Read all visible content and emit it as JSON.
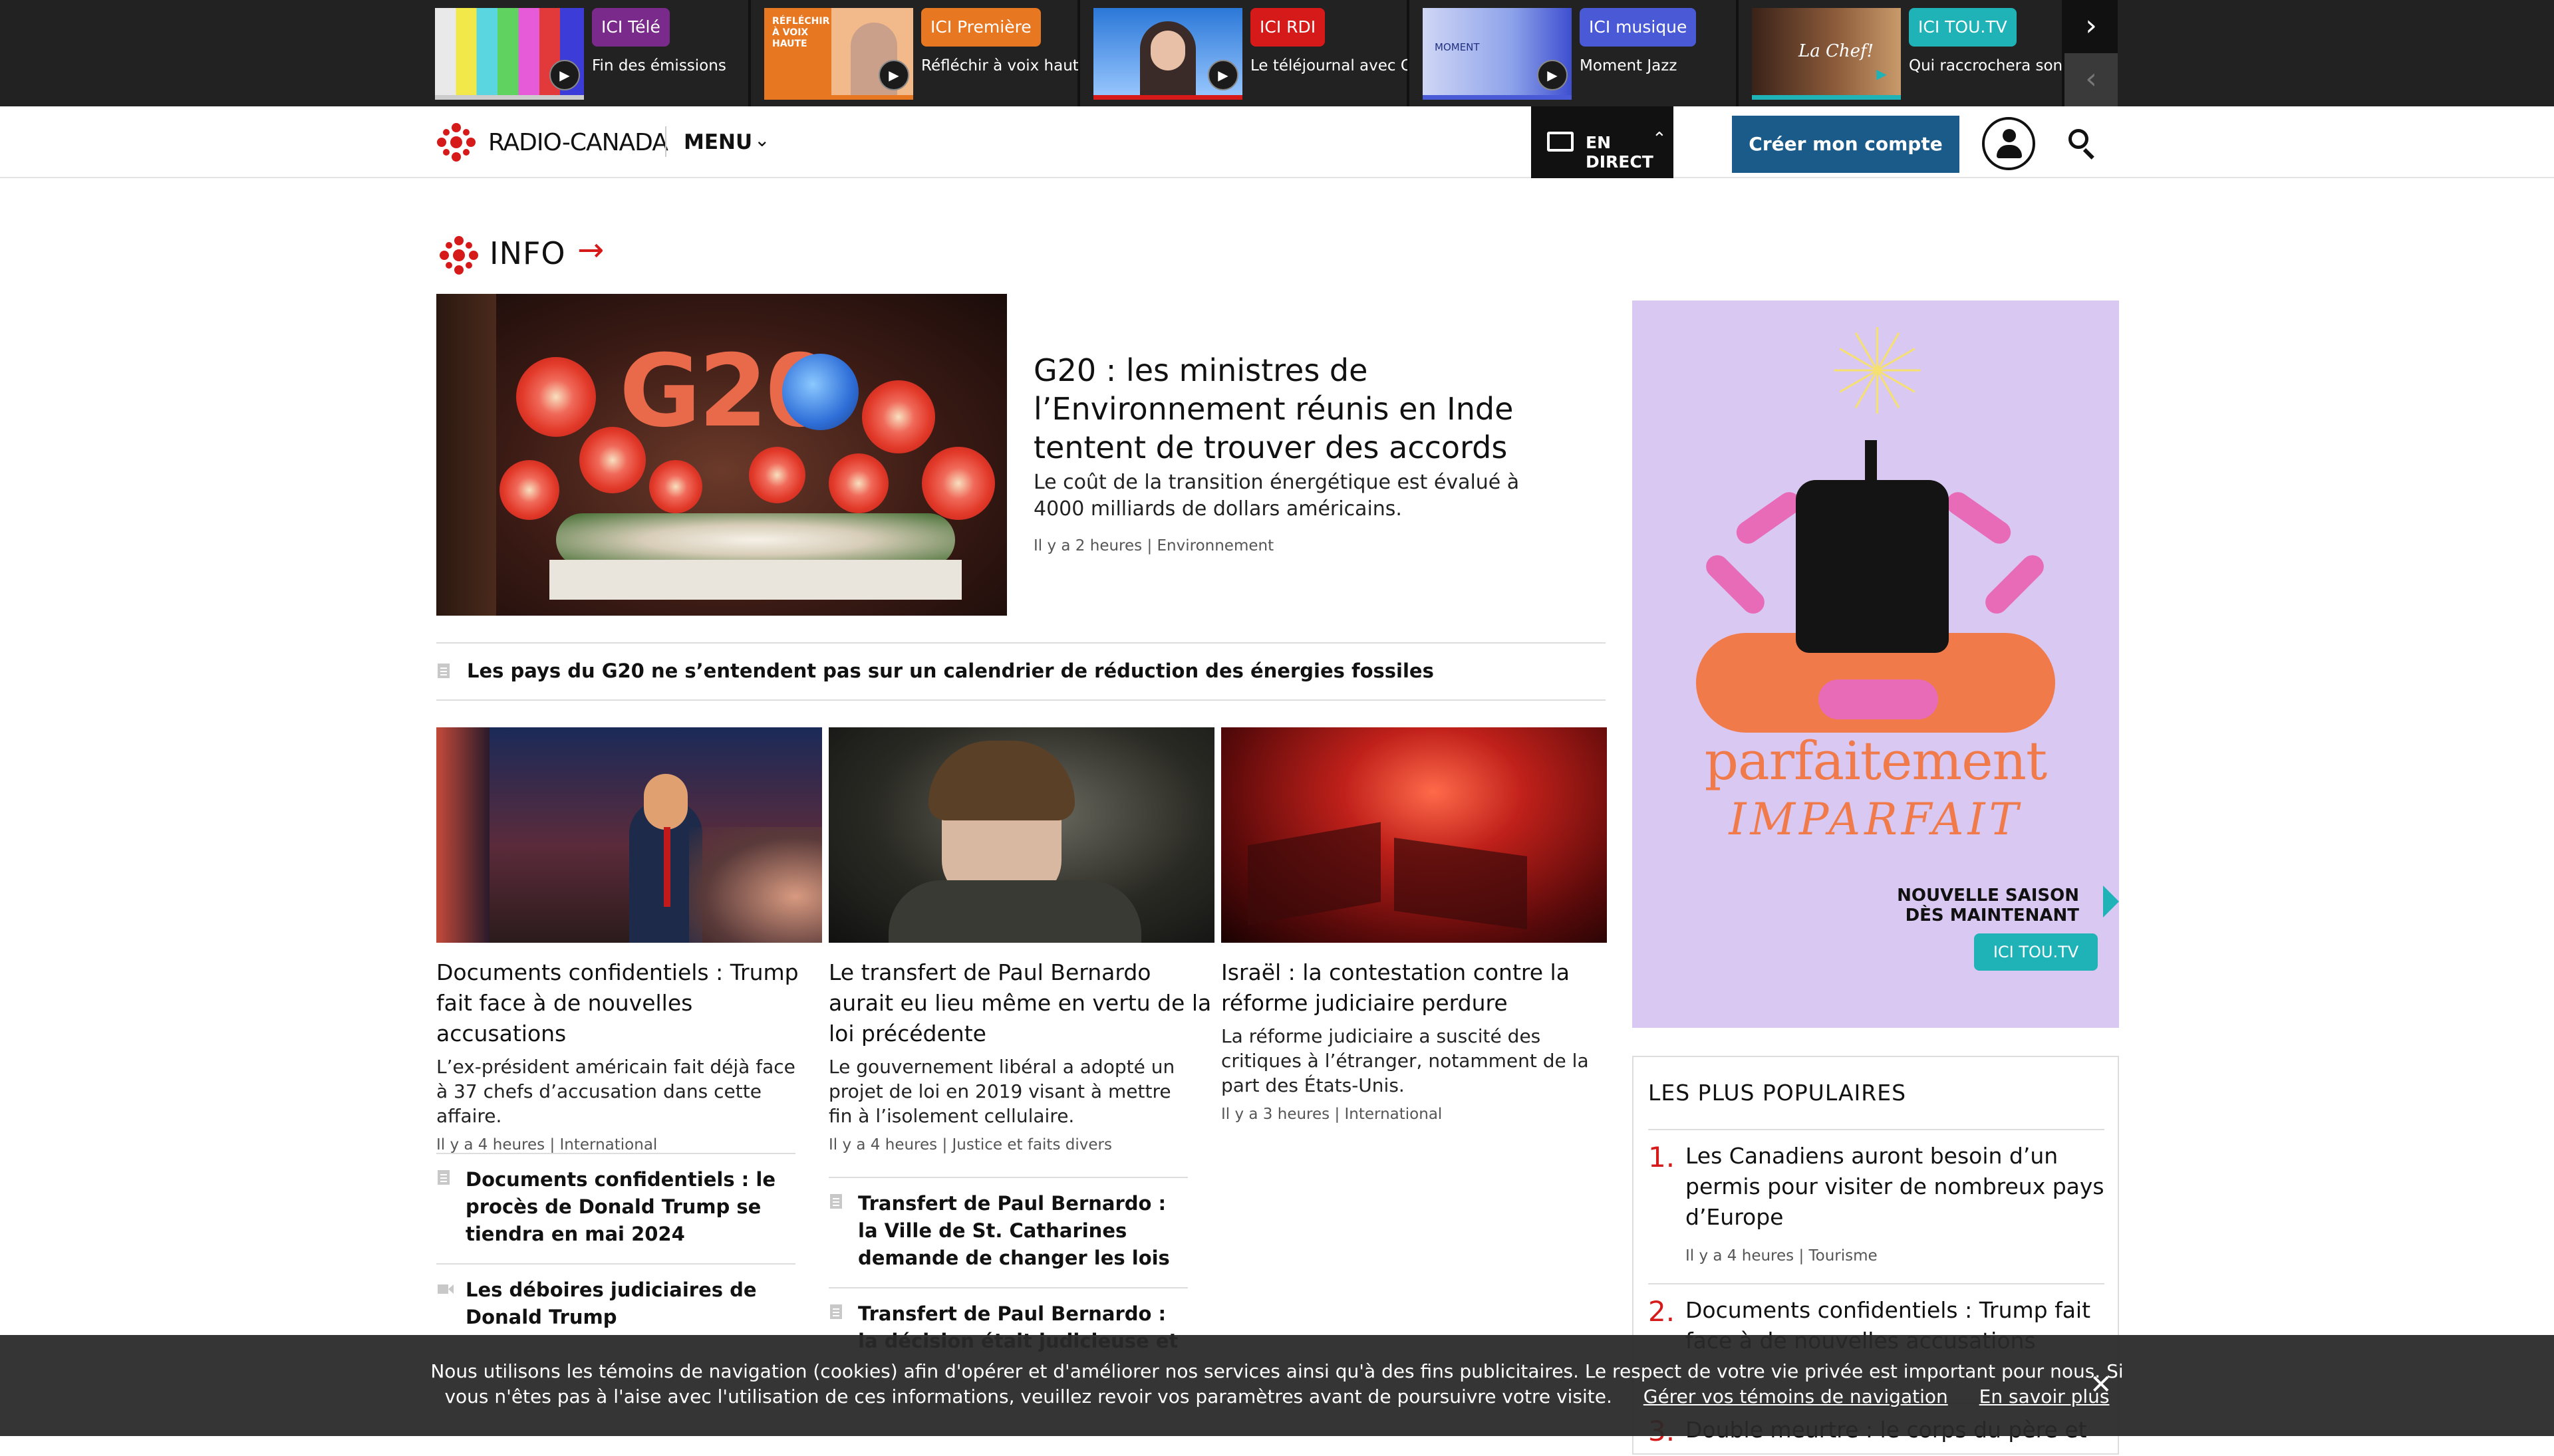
{
  "topstrip": {
    "cards": [
      {
        "brand": "ICI Télé",
        "title": "Fin des émissions",
        "brand_color": "#7a2a8a",
        "bar_color": "#cccccc"
      },
      {
        "brand": "ICI Première",
        "title": "Réfléchir à voix haute",
        "brand_color": "#e87722",
        "bar_color": "#e87722",
        "thumb_text": "RÉFLÉCHIR À VOIX HAUTE"
      },
      {
        "brand": "ICI RDI",
        "title": "Le téléjournal avec Cé",
        "brand_color": "#d61a1a",
        "bar_color": "#d61a1a"
      },
      {
        "brand": "ICI musique",
        "title": "Moment Jazz",
        "brand_color": "#4a5ad6",
        "bar_color": "#4a5ad6",
        "thumb_text": "MOMENT"
      },
      {
        "brand": "ICI TOU.TV",
        "title": "Qui raccrochera son t",
        "brand_color": "#1fb3b8",
        "bar_color": "#1fb3b8",
        "thumb_text": "La Chef!"
      }
    ],
    "next_icon": "chevron-right-icon",
    "prev_icon": "chevron-left-icon"
  },
  "header": {
    "logo_text": "RADIO-CANADA",
    "menu_label": "MENU",
    "live_label": "EN DIRECT",
    "create_account_label": "Créer mon compte",
    "user_icon": "user-icon",
    "search_icon": "search-icon",
    "brand_color": "#d61a1a",
    "button_color": "#1b5b8a"
  },
  "section": {
    "heading": "INFO"
  },
  "lead": {
    "title": "G20 : les ministres de l’Environnement réunis en Inde tentent de trouver des accords",
    "description": "Le coût de la transition énergétique est évalué à 4000 milliards  de dollars américains.",
    "meta": "Il y a 2 heures | Environnement",
    "image_text": "G20",
    "related": "Les pays du G20 ne s’entendent pas sur un calendrier de réduction des énergies fossiles"
  },
  "stories": [
    {
      "title": "Documents confidentiels : Trump fait face à de nouvelles accusations",
      "description": "L’ex-président américain fait déjà face à 37 chefs d’accusation dans cette affaire.",
      "meta": "Il y a 4 heures | International",
      "related": [
        {
          "text": "Documents confidentiels : le procès de Donald Trump se tiendra en mai 2024",
          "icon": "document-icon"
        },
        {
          "text": "Les déboires judiciaires de Donald Trump",
          "icon": "video-icon"
        }
      ]
    },
    {
      "title": "Le transfert de Paul Bernardo aurait eu lieu même en vertu de la loi précédente",
      "description": "Le gouvernement libéral a adopté un projet de loi en 2019 visant à mettre fin à l’isolement cellulaire.",
      "meta": "Il y a 4 heures | Justice et faits divers",
      "related": [
        {
          "text": "Transfert de Paul Bernardo : la Ville de St. Catharines demande de changer les lois",
          "icon": "document-icon"
        },
        {
          "text": "Transfert de Paul Bernardo : la décision était judicieuse et",
          "icon": "document-icon"
        }
      ]
    },
    {
      "title": "Israël : la contestation contre la réforme judiciaire perdure",
      "description": "La réforme judiciaire a suscité des critiques à l’étranger, notamment de la part des États-Unis.",
      "meta": "Il y a 3 heures | International",
      "related": []
    }
  ],
  "ad": {
    "title": "parfaitement",
    "subtitle": "IMPARFAIT",
    "season_line1": "NOUVELLE SAISON",
    "season_line2": "DÈS MAINTENANT",
    "logo": "ICI TOU.TV",
    "bg_color": "#d9c8f2",
    "accent_color": "#f07a4a"
  },
  "popular": {
    "title": "LES PLUS POPULAIRES",
    "items": [
      {
        "num": "1.",
        "text": "Les Canadiens auront besoin d’un permis pour visiter de nombreux pays d’Europe",
        "meta": "Il y a 4 heures | Tourisme"
      },
      {
        "num": "2.",
        "text": "Documents confidentiels : Trump fait face à de nouvelles accusations",
        "meta": ""
      },
      {
        "num": "3.",
        "text": "Double meurtre : le corps du père et",
        "meta": ""
      }
    ]
  },
  "cookie": {
    "text_line1": "Nous utilisons les témoins de navigation (cookies) afin d'opérer et d'améliorer nos services ainsi qu'à des fins publicitaires. Le respect de votre vie privée est important pour nous. Si",
    "text_line2": "vous n'êtes pas à l'aise avec l'utilisation de ces informations, veuillez revoir vos paramètres avant de poursuivre votre visite.",
    "manage_link": "Gérer vos témoins de navigation",
    "learn_more_link": "En savoir plus",
    "close_icon": "close-icon"
  }
}
